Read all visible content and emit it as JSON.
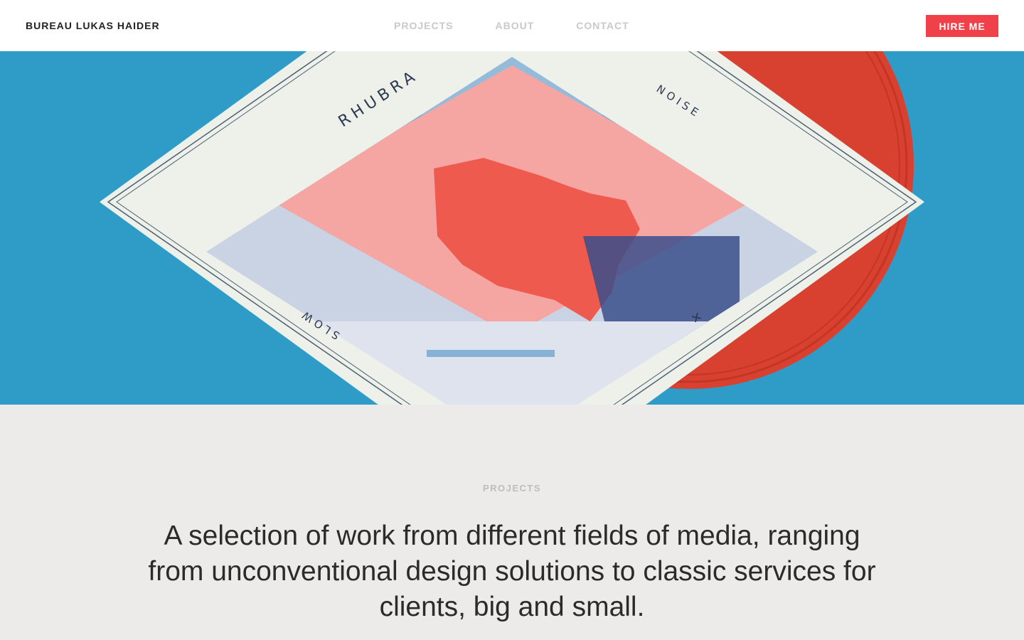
{
  "header": {
    "brand": "BUREAU LUKAS HAIDER",
    "nav": [
      "PROJECTS",
      "ABOUT",
      "CONTACT"
    ],
    "cta": "HIRE ME"
  },
  "hero": {
    "cover_title": "RHUBRA",
    "cover_top_right": "NOISE",
    "cover_bottom_left": "SLOW",
    "cover_mark": "✕",
    "colors": {
      "background": "#2f9bc7",
      "vinyl": "#d8412f",
      "sleeve": "#eef0ea",
      "artwork_pink": "#f6a6a2",
      "artwork_red": "#ef5a4e",
      "artwork_blue": "#5f9ccb"
    }
  },
  "projects": {
    "eyebrow": "PROJECTS",
    "lead": "A selection of work from different fields of media, ranging from unconventional design solutions to classic services for clients, big and small."
  },
  "colors": {
    "accent": "#f0414b",
    "nav_inactive": "#c9c9c9",
    "section_bg": "#ecebe9",
    "text": "#2b2b2b"
  }
}
